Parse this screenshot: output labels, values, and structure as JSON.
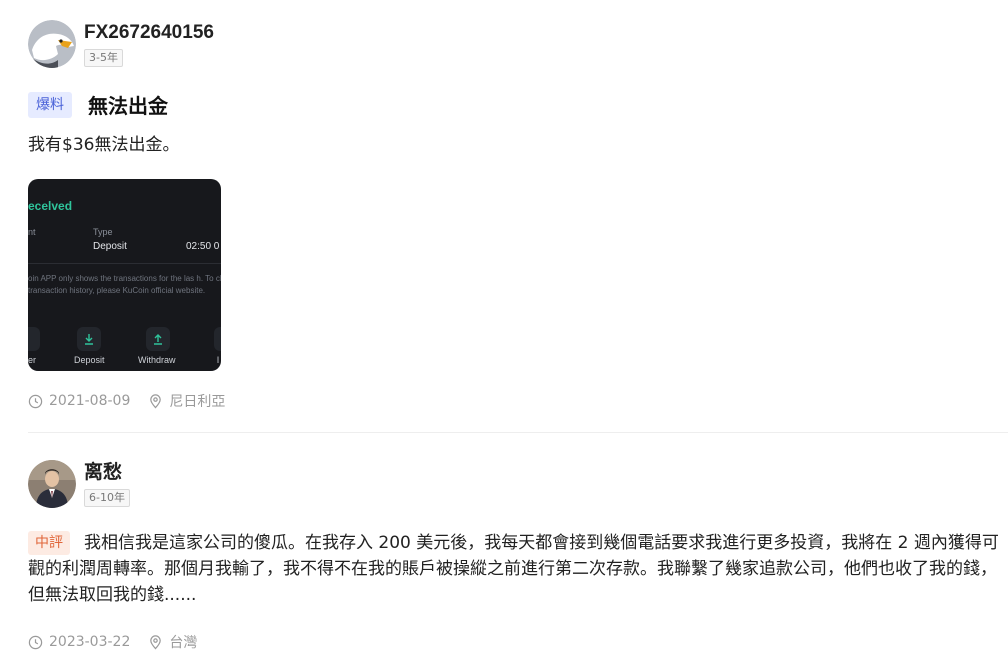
{
  "posts": [
    {
      "username": "FX2672640156",
      "experience": "3-5年",
      "tag": "爆料",
      "title": "無法出金",
      "text": "我有$36無法出金。",
      "screenshot": {
        "received": "ecelved",
        "col_left": "nt",
        "col_type": "Type",
        "type_value": "Deposit",
        "time": "02:50 0",
        "note": "oin APP only shows the transactions for the las h. To check your full transaction history, please KuCoin official website.",
        "btn_left_label": "er",
        "btn_deposit_label": "Deposit",
        "btn_withdraw_label": "Withdraw",
        "btn_right_label": "l"
      },
      "date": "2021-08-09",
      "location": "尼日利亞"
    },
    {
      "username": "离愁",
      "experience": "6-10年",
      "tag": "中評",
      "text": "我相信我是這家公司的傻瓜。在我存入 200 美元後，我每天都會接到幾個電話要求我進行更多投資，我將在 2 週內獲得可觀的利潤周轉率。那個月我輸了，我不得不在我的賬戶被操縱之前進行第二次存款。我聯繫了幾家追款公司，他們也收了我的錢，但無法取回我的錢......",
      "date": "2023-03-22",
      "location": "台灣"
    }
  ],
  "colors": {
    "tag_blue": "#4a62d8",
    "tag_orange": "#e0663a",
    "meta_gray": "#9a9a9a",
    "crypto_green": "#2fc49b"
  },
  "icons": [
    "eagle-avatar-icon",
    "clock-icon",
    "location-pin-icon",
    "download-icon",
    "upload-icon"
  ]
}
